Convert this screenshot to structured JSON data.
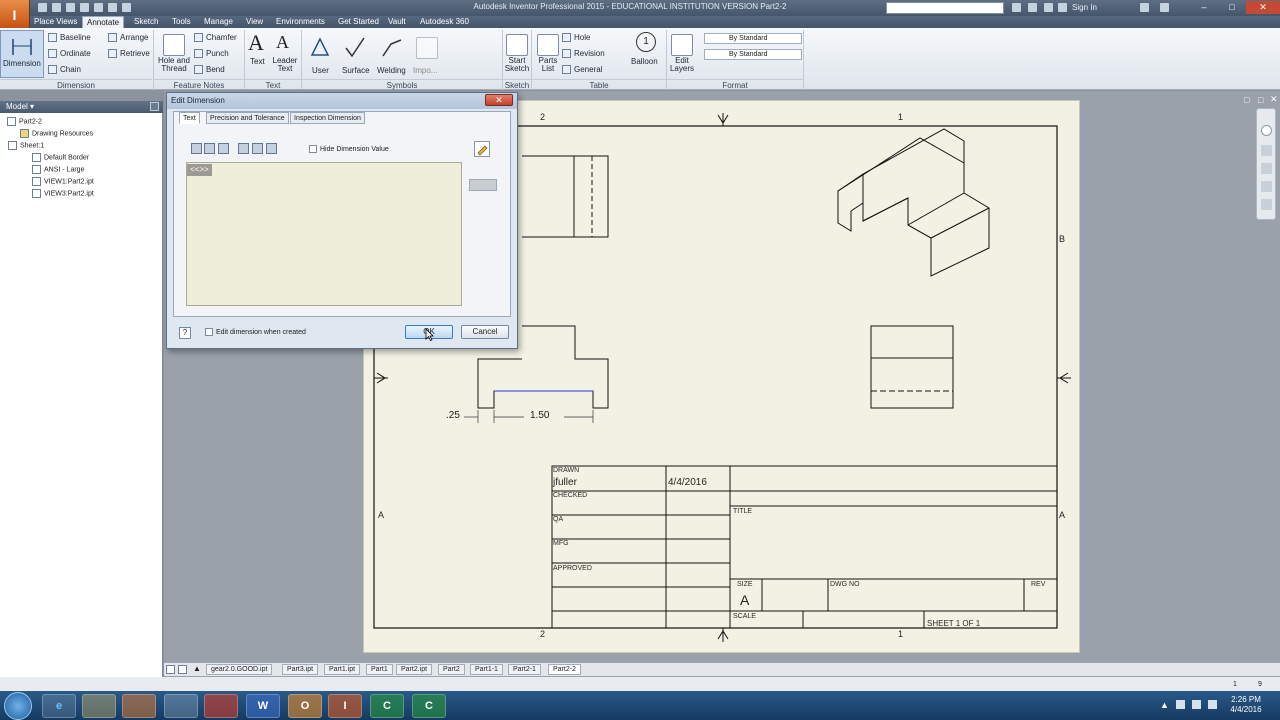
{
  "window": {
    "title": "Autodesk Inventor Professional 2015 - EDUCATIONAL INSTITUTION VERSION    Part2-2",
    "signin": "Sign In",
    "app_letter": "I"
  },
  "menu": {
    "tabs": [
      "Place Views",
      "Annotate",
      "Sketch",
      "Tools",
      "Manage",
      "View",
      "Environments",
      "Get Started",
      "Vault",
      "Autodesk 360"
    ],
    "active": "Annotate"
  },
  "ribbon": {
    "dimension": {
      "big": "Dimension",
      "baseline": "Baseline",
      "ordinate": "Ordinate",
      "chain": "Chain",
      "arrange": "Arrange",
      "retrieve": "Retrieve",
      "panel": "Dimension"
    },
    "feature_notes": {
      "hole_thread": "Hole and\nThread",
      "chamfer": "Chamfer",
      "punch": "Punch",
      "bend": "Bend",
      "panel": "Feature Notes"
    },
    "text": {
      "text": "Text",
      "leader_text": "Leader\nText",
      "panel": "Text"
    },
    "symbols": {
      "user": "User",
      "surface": "Surface",
      "welding": "Welding",
      "import": "Impo...",
      "panel": "Symbols"
    },
    "sketch": {
      "start_sketch": "Start\nSketch",
      "panel": "Sketch"
    },
    "table": {
      "parts_list": "Parts\nList",
      "hole": "Hole",
      "revision": "Revision",
      "general": "General",
      "balloon": "Balloon",
      "panel": "Table"
    },
    "format": {
      "edit_layers": "Edit\nLayers",
      "style1": "By Standard",
      "style2": "By Standard",
      "panel": "Format"
    }
  },
  "browser": {
    "header": "Model",
    "items": [
      "Part2-2",
      "Drawing Resources",
      "Sheet:1",
      "Default Border",
      "ANSI - Large",
      "VIEW1:Part2.ipt",
      "VIEW3:Part2.ipt"
    ]
  },
  "drawing": {
    "zone_top_left": "2",
    "zone_top_right": "1",
    "zone_bottom_left": "2",
    "zone_bottom_right": "1",
    "zone_left": "A",
    "zone_right_upper": "B",
    "zone_right": "A",
    "dim_small": ".25",
    "dim_main": "1.50",
    "title_block": {
      "drawn": "DRAWN",
      "drawn_by": "jfuller",
      "date": "4/4/2016",
      "checked": "CHECKED",
      "qa": "QA",
      "mfg": "MFG",
      "approved": "APPROVED",
      "title": "TITLE",
      "size_label": "SIZE",
      "size": "A",
      "dwg_no": "DWG NO",
      "rev": "REV",
      "scale": "SCALE",
      "sheet": "SHEET 1  OF 1"
    }
  },
  "dialog": {
    "title": "Edit Dimension",
    "tabs": [
      "Text",
      "Precision and Tolerance",
      "Inspection Dimension"
    ],
    "hide_value": "Hide Dimension Value",
    "token": "<<>>",
    "edit_when_created": "Edit dimension when created",
    "ok": "OK",
    "cancel": "Cancel"
  },
  "status": {
    "doc_tabs": [
      "gear2.0.GOOD.ipt",
      "Part3.ipt",
      "Part1.ipt",
      "Part1",
      "Part2.ipt",
      "Part2",
      "Part1-1",
      "Part2-1",
      "Part2-2"
    ],
    "active_tab": "Part2-2",
    "counter_left": "1",
    "counter_right": "9"
  },
  "taskbar": {
    "apps": [
      "e",
      "",
      "",
      "",
      "",
      "W",
      "O",
      "I",
      "C",
      "C"
    ],
    "time": "2:26 PM",
    "date": "4/4/2016"
  }
}
